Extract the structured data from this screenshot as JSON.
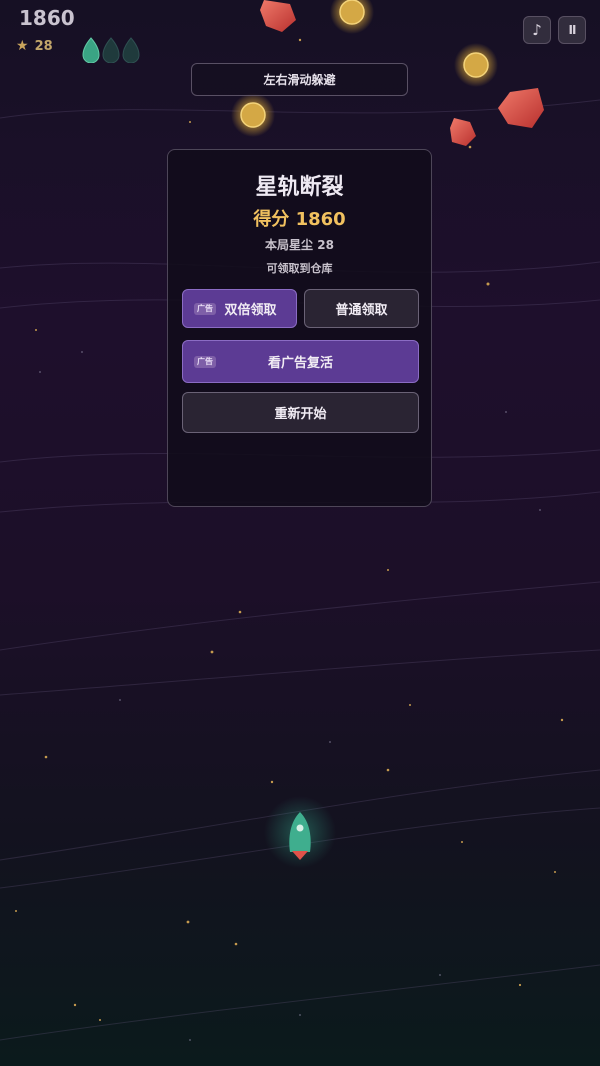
{
  "hud": {
    "score": "1860",
    "stardust": "28",
    "star_icon": "★",
    "lives_total": 3,
    "lives_remaining": 1,
    "music_icon": "♪",
    "pause_icon": "II"
  },
  "hint": "左右滑动躲避",
  "panel": {
    "title": "星轨断裂",
    "score_line": "得分 1860",
    "stardust_line": "本局星尘 28",
    "note": "可领取到仓库",
    "ad_tag": "广告",
    "double_claim": "双倍领取",
    "normal_claim": "普通领取",
    "revive": "看广告复活",
    "restart": "重新开始"
  },
  "colors": {
    "accent_purple": "#5c3b94",
    "score_gold": "#f1c15f",
    "ship_teal": "#3fae8e",
    "life_active": "#3aa484",
    "asteroid": "#e45a52"
  }
}
